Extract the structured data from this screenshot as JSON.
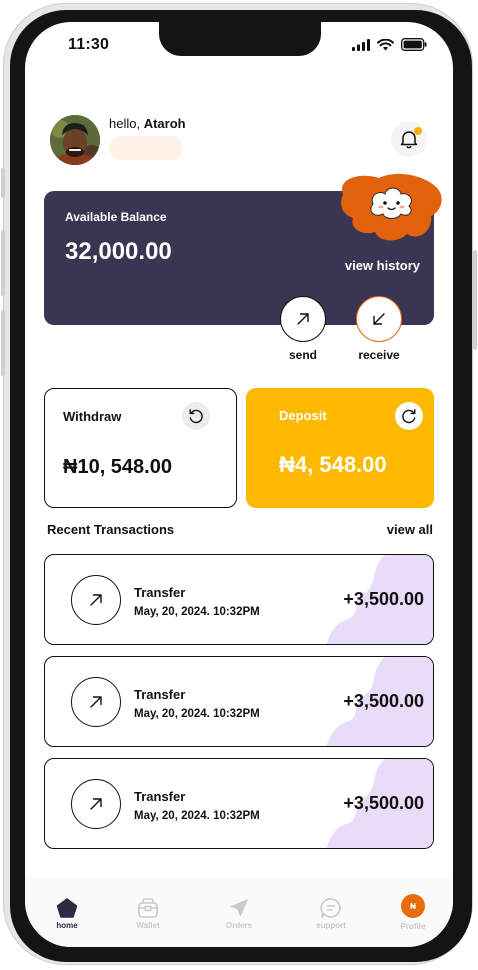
{
  "status_bar": {
    "time": "11:30"
  },
  "header": {
    "greeting": "hello,",
    "username": "Ataroh"
  },
  "balance_card": {
    "label": "Available Balance",
    "amount": "32,000.00",
    "view_history": "view history"
  },
  "actions": {
    "send_label": "send",
    "receive_label": "receive"
  },
  "withdraw": {
    "title": "Withdraw",
    "amount": "₦10, 548.00"
  },
  "deposit": {
    "title": "Deposit",
    "amount": "₦4, 548.00"
  },
  "transactions": {
    "title": "Recent Transactions",
    "view_all": "view all",
    "items": [
      {
        "type": "Transfer",
        "date": "May, 20, 2024. 10:32PM",
        "amount": "+3,500.00"
      },
      {
        "type": "Transfer",
        "date": "May, 20, 2024. 10:32PM",
        "amount": "+3,500.00"
      },
      {
        "type": "Transfer",
        "date": "May, 20, 2024. 10:32PM",
        "amount": "+3,500.00"
      }
    ]
  },
  "bottom_nav": {
    "items": [
      {
        "label": "home",
        "icon": "home-pentagon-icon",
        "active": true
      },
      {
        "label": "Wallet",
        "icon": "wallet-icon",
        "active": false
      },
      {
        "label": "Orders",
        "icon": "send-plane-icon",
        "active": false
      },
      {
        "label": "support",
        "icon": "chat-icon",
        "active": false
      },
      {
        "label": "Profile",
        "icon": "profile-badge",
        "active": false,
        "badge": "₦"
      }
    ]
  },
  "colors": {
    "card_dark": "#3a3552",
    "deposit_yellow": "#fcb900",
    "accent_orange": "#e86c0c",
    "blob_lavender": "#e9dcf8",
    "pill_peach": "#fff1e6"
  }
}
